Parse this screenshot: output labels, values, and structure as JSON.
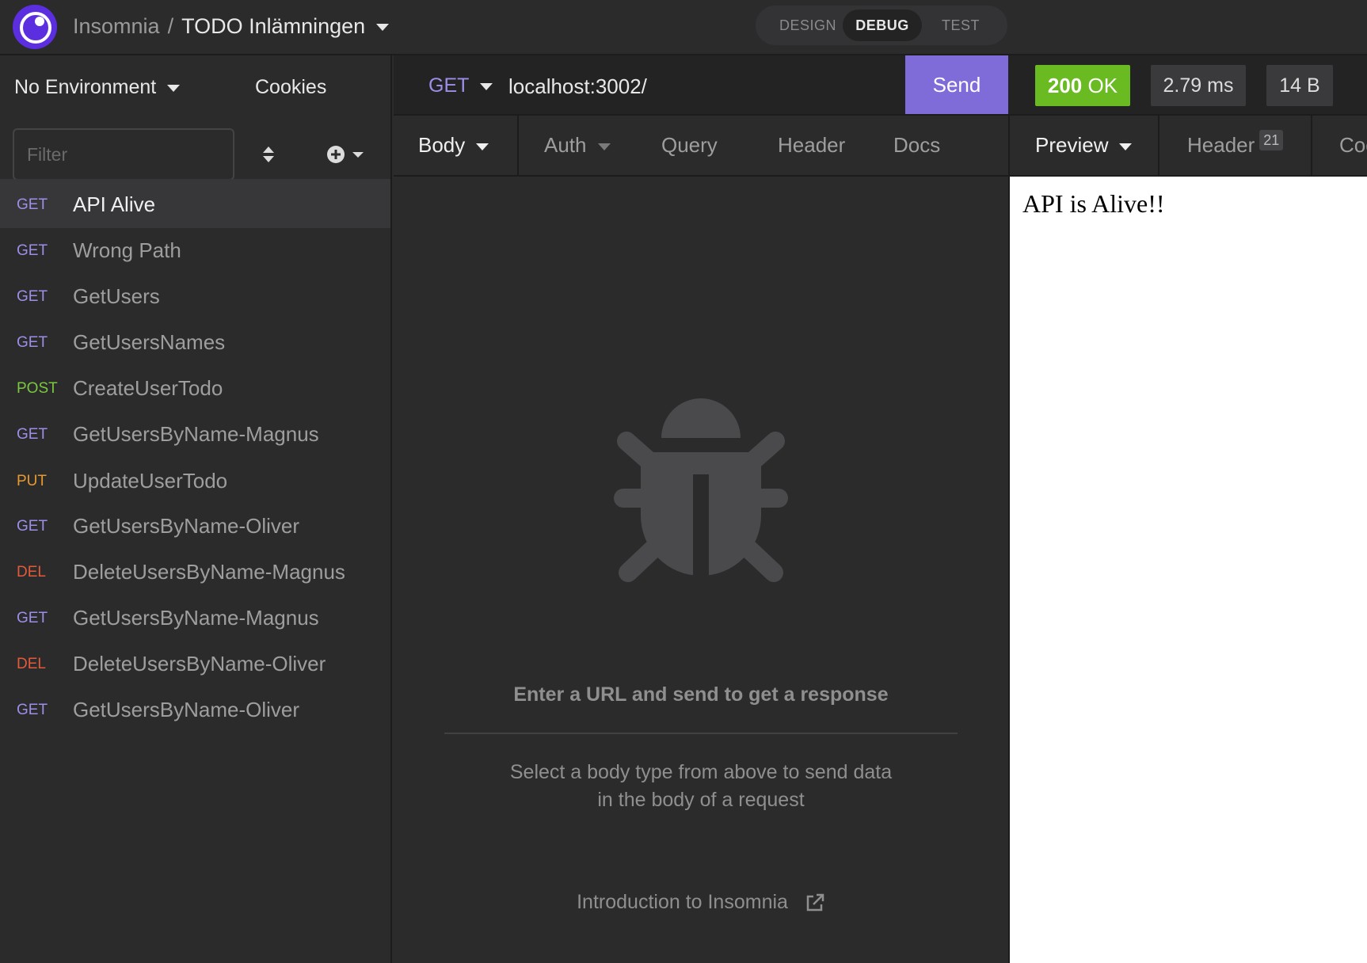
{
  "header": {
    "app_name": "Insomnia",
    "separator": "/",
    "workspace": "TODO Inlämningen",
    "modes": [
      "DESIGN",
      "DEBUG",
      "TEST"
    ],
    "active_mode": "DEBUG"
  },
  "sidebar": {
    "environment": "No Environment",
    "cookies": "Cookies",
    "filter_placeholder": "Filter",
    "requests": [
      {
        "method": "GET",
        "name": "API Alive",
        "active": true
      },
      {
        "method": "GET",
        "name": "Wrong Path"
      },
      {
        "method": "GET",
        "name": "GetUsers"
      },
      {
        "method": "GET",
        "name": "GetUsersNames"
      },
      {
        "method": "POST",
        "name": "CreateUserTodo"
      },
      {
        "method": "GET",
        "name": "GetUsersByName-Magnus"
      },
      {
        "method": "PUT",
        "name": "UpdateUserTodo"
      },
      {
        "method": "GET",
        "name": "GetUsersByName-Oliver"
      },
      {
        "method": "DEL",
        "name": "DeleteUsersByName-Magnus"
      },
      {
        "method": "GET",
        "name": "GetUsersByName-Magnus"
      },
      {
        "method": "DEL",
        "name": "DeleteUsersByName-Oliver"
      },
      {
        "method": "GET",
        "name": "GetUsersByName-Oliver"
      }
    ]
  },
  "request": {
    "method": "GET",
    "url": "localhost:3002/",
    "send_label": "Send",
    "tabs": [
      "Body",
      "Auth",
      "Query",
      "Header",
      "Docs"
    ],
    "empty_title": "Enter a URL and send to get a response",
    "empty_line1": "Select a body type from above to send data",
    "empty_line2": "in the body of a request",
    "intro_link": "Introduction to Insomnia"
  },
  "response": {
    "status_code": "200",
    "status_text": "OK",
    "time": "2.79 ms",
    "size": "14 B",
    "tabs": [
      "Preview",
      "Header",
      "Coo"
    ],
    "header_count": "21",
    "preview_text": "API is Alive!!"
  },
  "colors": {
    "GET": "#9e8ee8",
    "POST": "#7ac83e",
    "PUT": "#e69a2e",
    "DEL": "#e25a3a",
    "send": "#7f6cd8",
    "status_ok": "#6aba22"
  }
}
